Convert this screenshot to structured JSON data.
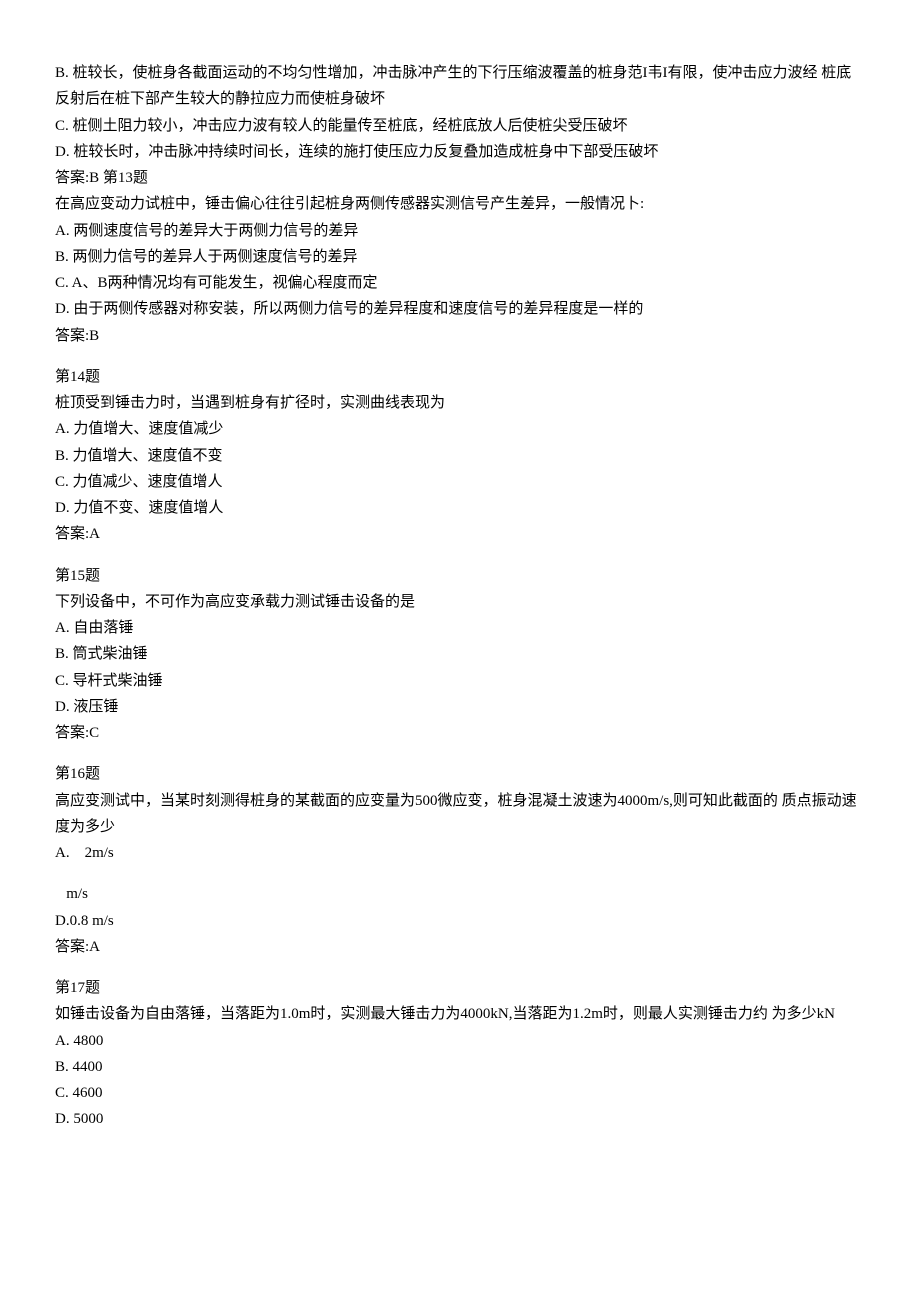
{
  "q12": {
    "optB": "B. 桩较长，使桩身各截面运动的不均匀性增加，冲击脉冲产生的下行压缩波覆盖的桩身范I韦I有限，使冲击应力波经  桩底反射后在桩下部产生较大的静拉应力而使桩身破坏",
    "optC": "C. 桩侧土阻力较小，冲击应力波有较人的能量传至桩底，经桩底放人后使桩尖受压破坏",
    "optD": "D. 桩较长时，冲击脉冲持续时间长，连续的施打使压应力反复叠加造成桩身中下部受压破坏",
    "answer": "答案:B 第13题"
  },
  "q13": {
    "stem": "在高应变动力试桩中，锤击偏心往往引起桩身两侧传感器实测信号产生差异，一般情况卜:",
    "optA": "A. 两侧速度信号的差异大于两侧力信号的差异",
    "optB": "B. 两侧力信号的差异人于两侧速度信号的差异",
    "optC": "C. A、B两种情况均有可能发生，视偏心程度而定",
    "optD": "D. 由于两侧传感器对称安装，所以两侧力信号的差异程度和速度信号的差异程度是一样的",
    "answer": "答案:B"
  },
  "q14": {
    "title": "第14题",
    "stem": "桩顶受到锤击力时，当遇到桩身有扩径时，实测曲线表现为",
    "optA": "A. 力值增大、速度值减少",
    "optB": "B. 力值增大、速度值不变",
    "optC": "C. 力值减少、速度值增人",
    "optD": "D. 力值不变、速度值增人",
    "answer": "答案:A"
  },
  "q15": {
    "title": "第15题",
    "stem": "下列设备中，不可作为高应变承载力测试锤击设备的是",
    "optA": "A. 自由落锤",
    "optB": "B. 筒式柴油锤",
    "optC": "C. 导杆式柴油锤",
    "optD": "D. 液压锤",
    "answer": "答案:C"
  },
  "q16": {
    "title": "第16题",
    "stem": "高应变测试中，当某时刻测得桩身的某截面的应变量为500微应变，桩身混凝土波速为4000m/s,则可知此截面的  质点振动速度为多少",
    "optA": "A.　2m/s",
    "line2": "   m/s",
    "optD": "D.0.8 m/s",
    "answer": "答案:A"
  },
  "q17": {
    "title": "第17题",
    "stem": "如锤击设备为自由落锤，当落距为1.0m时，实测最大锤击力为4000kN,当落距为1.2m时，则最人实测锤击力约  为多少kN",
    "optA": "A. 4800",
    "optB": "B. 4400",
    "optC": "C. 4600",
    "optD": "D. 5000"
  }
}
